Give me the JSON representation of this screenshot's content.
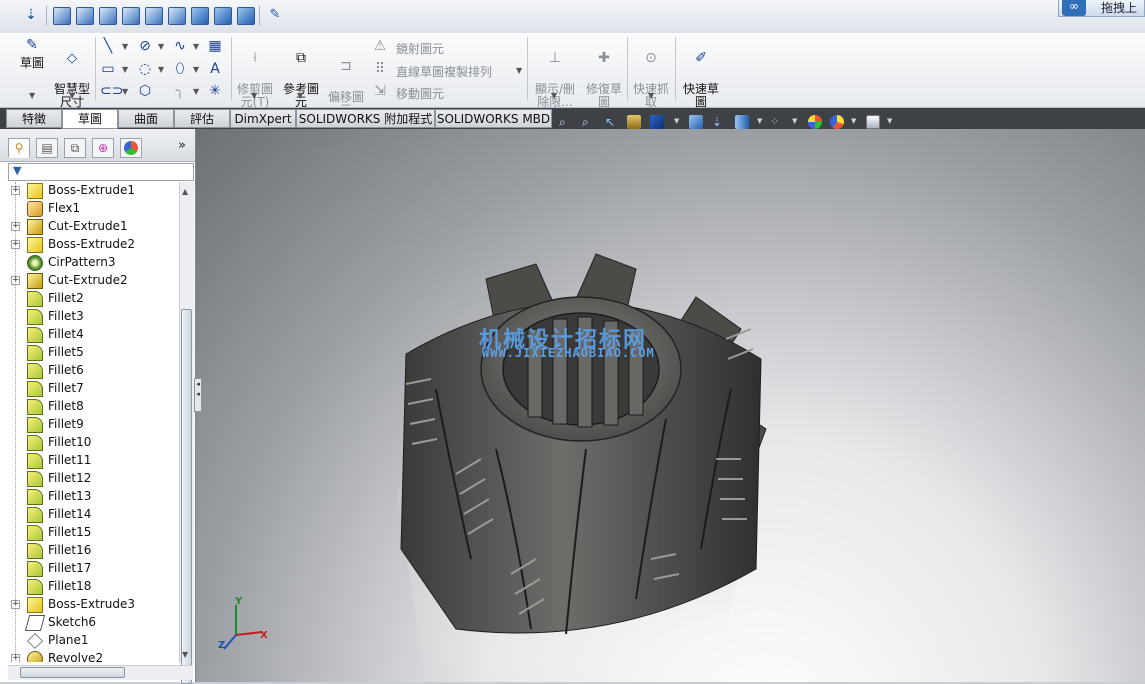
{
  "quick_access": {
    "icons": [
      "normal-to-icon",
      "view-front-icon",
      "view-back-icon",
      "view-left-icon",
      "view-right-icon",
      "view-top-icon",
      "view-bottom-icon",
      "view-isometric-icon",
      "view-trimetric-icon",
      "link-views-icon"
    ]
  },
  "upload_button": {
    "label": "拖拽上"
  },
  "ribbon": {
    "sketch": "草圖",
    "smart_dimension": "智慧型\n尺寸",
    "trim": "修剪圖\n元(T)",
    "convert": "參考圖\n元",
    "offset": "偏移圖\n元",
    "mirror": "鏡射圖元",
    "linear_pattern": "直線草圖複製排列",
    "move": "移動圖元",
    "show_hide": "顯示/刪\n除限...",
    "repair": "修復草\n圖",
    "quick_snaps": "快速抓\n取",
    "rapid_sketch": "快速草\n圖"
  },
  "tabs": [
    {
      "label": "特徵",
      "active": false
    },
    {
      "label": "草圖",
      "active": true
    },
    {
      "label": "曲面",
      "active": false
    },
    {
      "label": "評估",
      "active": false
    },
    {
      "label": "DimXpert",
      "active": false
    },
    {
      "label": "SOLIDWORKS 附加程式",
      "active": false
    },
    {
      "label": "SOLIDWORKS MBD",
      "active": false
    }
  ],
  "panel": {
    "more": "»",
    "tree": [
      {
        "label": "Boss-Extrude1",
        "icon": "extrude",
        "expand": true
      },
      {
        "label": "Flex1",
        "icon": "flex",
        "expand": false
      },
      {
        "label": "Cut-Extrude1",
        "icon": "cut",
        "expand": true
      },
      {
        "label": "Boss-Extrude2",
        "icon": "extrude",
        "expand": true
      },
      {
        "label": "CirPattern3",
        "icon": "pattern",
        "expand": false
      },
      {
        "label": "Cut-Extrude2",
        "icon": "cut",
        "expand": true
      },
      {
        "label": "Fillet2",
        "icon": "fillet",
        "expand": false
      },
      {
        "label": "Fillet3",
        "icon": "fillet",
        "expand": false
      },
      {
        "label": "Fillet4",
        "icon": "fillet",
        "expand": false
      },
      {
        "label": "Fillet5",
        "icon": "fillet",
        "expand": false
      },
      {
        "label": "Fillet6",
        "icon": "fillet",
        "expand": false
      },
      {
        "label": "Fillet7",
        "icon": "fillet",
        "expand": false
      },
      {
        "label": "Fillet8",
        "icon": "fillet",
        "expand": false
      },
      {
        "label": "Fillet9",
        "icon": "fillet",
        "expand": false
      },
      {
        "label": "Fillet10",
        "icon": "fillet",
        "expand": false
      },
      {
        "label": "Fillet11",
        "icon": "fillet",
        "expand": false
      },
      {
        "label": "Fillet12",
        "icon": "fillet",
        "expand": false
      },
      {
        "label": "Fillet13",
        "icon": "fillet",
        "expand": false
      },
      {
        "label": "Fillet14",
        "icon": "fillet",
        "expand": false
      },
      {
        "label": "Fillet15",
        "icon": "fillet",
        "expand": false
      },
      {
        "label": "Fillet16",
        "icon": "fillet",
        "expand": false
      },
      {
        "label": "Fillet17",
        "icon": "fillet",
        "expand": false
      },
      {
        "label": "Fillet18",
        "icon": "fillet",
        "expand": false
      },
      {
        "label": "Boss-Extrude3",
        "icon": "extrude",
        "expand": true
      },
      {
        "label": "Sketch6",
        "icon": "sketch",
        "expand": false
      },
      {
        "label": "Plane1",
        "icon": "plane",
        "expand": false
      },
      {
        "label": "Revolve2",
        "icon": "revolve",
        "expand": true
      }
    ]
  },
  "viewport": {
    "watermark_title": "机械设计招标网",
    "watermark_url": "WWW.JIXIEZHAOBIAO.COM",
    "triad": {
      "x": "X",
      "y": "Y",
      "z": "Z"
    }
  },
  "colors": {
    "tab_bar": "#3e4145",
    "watermark": "#5aa0e8"
  }
}
